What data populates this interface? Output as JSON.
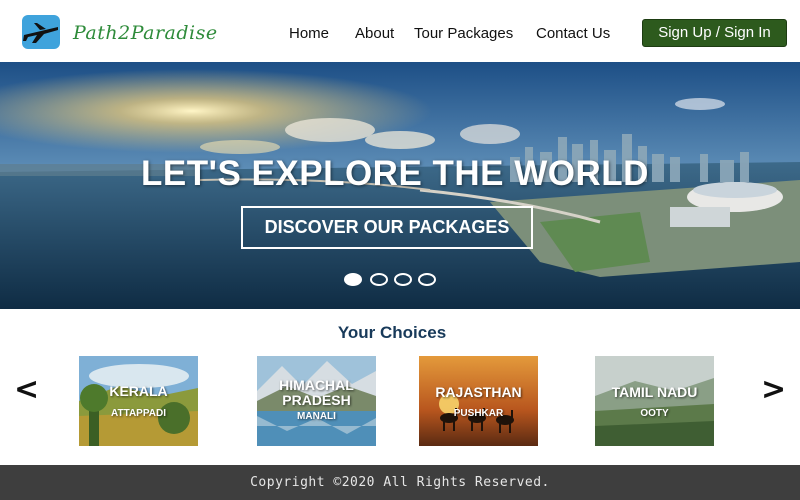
{
  "brand": {
    "name": "Path2Paradise",
    "logo_icon": "airplane-icon"
  },
  "nav": {
    "home": "Home",
    "about": "About",
    "tour_packages": "Tour Packages",
    "contact": "Contact Us"
  },
  "auth": {
    "signin_label": "Sign Up / Sign In"
  },
  "hero": {
    "title": "LET'S EXPLORE THE WORLD",
    "button_label": "DISCOVER OUR PACKAGES",
    "slides_count": 4,
    "active_slide": 1
  },
  "choices": {
    "heading": "Your Choices",
    "prev_arrow": "<",
    "next_arrow": ">",
    "cards": [
      {
        "title": "KERALA",
        "subtitle": "ATTAPPADI"
      },
      {
        "title": "HIMACHAL PRADESH",
        "subtitle": "MANALI"
      },
      {
        "title": "RAJASTHAN",
        "subtitle": "PUSHKAR"
      },
      {
        "title": "TAMIL NADU",
        "subtitle": "OOTY"
      }
    ]
  },
  "footer": {
    "copyright": "Copyright ©2020 All Rights Reserved."
  },
  "colors": {
    "brand_green": "#2e8b3a",
    "button_green": "#2d5a1d",
    "footer_bg": "#3e3e3e",
    "heading_blue": "#183a5a"
  }
}
